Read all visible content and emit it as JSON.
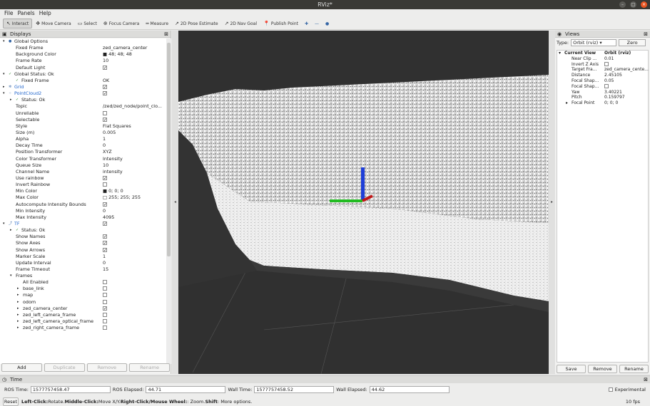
{
  "window": {
    "title": "RViz*"
  },
  "menu": [
    "File",
    "Panels",
    "Help"
  ],
  "toolbar": [
    {
      "label": "Interact",
      "icon": "interact-icon",
      "glyph": "↖",
      "active": true
    },
    {
      "label": "Move Camera",
      "icon": "move-camera-icon",
      "glyph": "✥"
    },
    {
      "label": "Select",
      "icon": "select-icon",
      "glyph": "▭"
    },
    {
      "label": "Focus Camera",
      "icon": "focus-camera-icon",
      "glyph": "⊕"
    },
    {
      "label": "Measure",
      "icon": "measure-icon",
      "glyph": "═"
    },
    {
      "label": "2D Pose Estimate",
      "icon": "pose-estimate-icon",
      "glyph": "↗"
    },
    {
      "label": "2D Nav Goal",
      "icon": "nav-goal-icon",
      "glyph": "↗"
    },
    {
      "label": "Publish Point",
      "icon": "publish-point-icon",
      "glyph": "📍"
    }
  ],
  "toolbar_extra": [
    "✚",
    "—",
    "●"
  ],
  "displays": {
    "title": "Displays",
    "rows": [
      {
        "label": "Global Options",
        "indent": 0,
        "arrow": "▾",
        "icon": "●",
        "value": ""
      },
      {
        "label": "Fixed Frame",
        "indent": 1,
        "value": "zed_camera_center"
      },
      {
        "label": "Background Color",
        "indent": 1,
        "value": "■ 48; 48; 48"
      },
      {
        "label": "Frame Rate",
        "indent": 1,
        "value": "10"
      },
      {
        "label": "Default Light",
        "indent": 1,
        "value": "✓",
        "check": true
      },
      {
        "label": "Global Status: Ok",
        "indent": 0,
        "arrow": "▾",
        "icon": "✓",
        "value": ""
      },
      {
        "label": "Fixed Frame",
        "indent": 1,
        "icon": "✓",
        "value": "OK"
      },
      {
        "label": "Grid",
        "indent": 0,
        "arrow": "▸",
        "icon": "✲",
        "value": "✓",
        "check": true,
        "blue": true
      },
      {
        "label": "PointCloud2",
        "indent": 0,
        "arrow": "▾",
        "icon": "⁘",
        "value": "✓",
        "check": true,
        "blue": true
      },
      {
        "label": "Status: Ok",
        "indent": 1,
        "arrow": "▸",
        "icon": "✓",
        "value": ""
      },
      {
        "label": "Topic",
        "indent": 1,
        "value": "/zed/zed_node/point_clo..."
      },
      {
        "label": "Unreliable",
        "indent": 1,
        "value": "",
        "check": true
      },
      {
        "label": "Selectable",
        "indent": 1,
        "value": "✓",
        "check": true
      },
      {
        "label": "Style",
        "indent": 1,
        "value": "Flat Squares"
      },
      {
        "label": "Size (m)",
        "indent": 1,
        "value": "0.005"
      },
      {
        "label": "Alpha",
        "indent": 1,
        "value": "1"
      },
      {
        "label": "Decay Time",
        "indent": 1,
        "value": "0"
      },
      {
        "label": "Position Transformer",
        "indent": 1,
        "value": "XYZ"
      },
      {
        "label": "Color Transformer",
        "indent": 1,
        "value": "Intensity"
      },
      {
        "label": "Queue Size",
        "indent": 1,
        "value": "10"
      },
      {
        "label": "Channel Name",
        "indent": 1,
        "value": "intensity"
      },
      {
        "label": "Use rainbow",
        "indent": 1,
        "value": "✓",
        "check": true
      },
      {
        "label": "Invert Rainbow",
        "indent": 1,
        "value": "",
        "check": true
      },
      {
        "label": "Min Color",
        "indent": 1,
        "value": "■ 0; 0; 0"
      },
      {
        "label": "Max Color",
        "indent": 1,
        "value": "□ 255; 255; 255"
      },
      {
        "label": "Autocompute Intensity Bounds",
        "indent": 1,
        "value": "✓",
        "check": true
      },
      {
        "label": "Min Intensity",
        "indent": 1,
        "value": "0"
      },
      {
        "label": "Max Intensity",
        "indent": 1,
        "value": "4095"
      },
      {
        "label": "TF",
        "indent": 0,
        "arrow": "▾",
        "icon": "⤴",
        "value": "✓",
        "check": true,
        "blue": true
      },
      {
        "label": "Status: Ok",
        "indent": 1,
        "arrow": "▸",
        "icon": "✓",
        "value": ""
      },
      {
        "label": "Show Names",
        "indent": 1,
        "value": "✓",
        "check": true
      },
      {
        "label": "Show Axes",
        "indent": 1,
        "value": "✓",
        "check": true
      },
      {
        "label": "Show Arrows",
        "indent": 1,
        "value": "✓",
        "check": true
      },
      {
        "label": "Marker Scale",
        "indent": 1,
        "value": "1"
      },
      {
        "label": "Update Interval",
        "indent": 1,
        "value": "0"
      },
      {
        "label": "Frame Timeout",
        "indent": 1,
        "value": "15"
      },
      {
        "label": "Frames",
        "indent": 1,
        "arrow": "▾",
        "value": ""
      },
      {
        "label": "All Enabled",
        "indent": 2,
        "value": "",
        "check": true
      },
      {
        "label": "base_link",
        "indent": 2,
        "arrow": "▸",
        "value": "",
        "check": true
      },
      {
        "label": "map",
        "indent": 2,
        "arrow": "▸",
        "value": "",
        "check": true
      },
      {
        "label": "odom",
        "indent": 2,
        "arrow": "▸",
        "value": "",
        "check": true
      },
      {
        "label": "zed_camera_center",
        "indent": 2,
        "arrow": "▸",
        "value": "✓",
        "check": true
      },
      {
        "label": "zed_left_camera_frame",
        "indent": 2,
        "arrow": "▸",
        "value": "",
        "check": true
      },
      {
        "label": "zed_left_camera_optical_frame",
        "indent": 2,
        "arrow": "▸",
        "value": "",
        "check": true
      },
      {
        "label": "zed_right_camera_frame",
        "indent": 2,
        "arrow": "▸",
        "value": "",
        "check": true
      }
    ],
    "buttons": [
      {
        "label": "Add",
        "enabled": true
      },
      {
        "label": "Duplicate",
        "enabled": false
      },
      {
        "label": "Remove",
        "enabled": false
      },
      {
        "label": "Rename",
        "enabled": false
      }
    ]
  },
  "views": {
    "title": "Views",
    "type_label": "Type:",
    "type_value": "Orbit (rviz)",
    "zero_label": "Zero",
    "current_view": {
      "label": "Current View",
      "value": "Orbit (rviz)"
    },
    "rows": [
      {
        "label": "Near Clip ...",
        "value": "0.01"
      },
      {
        "label": "Invert Z Axis",
        "value": "",
        "check": true
      },
      {
        "label": "Target Fra...",
        "value": "zed_camera_cente..."
      },
      {
        "label": "Distance",
        "value": "2.45105"
      },
      {
        "label": "Focal Shap...",
        "value": "0.05"
      },
      {
        "label": "Focal Shap...",
        "value": "",
        "check": true
      },
      {
        "label": "Yaw",
        "value": "3.40221"
      },
      {
        "label": "Pitch",
        "value": "0.159797"
      },
      {
        "label": "Focal Point",
        "value": "0; 0; 0",
        "arrow": "▸"
      }
    ],
    "buttons": [
      "Save",
      "Remove",
      "Rename"
    ]
  },
  "time": {
    "title": "Time",
    "ros_time_label": "ROS Time:",
    "ros_time": "1577757458.47",
    "ros_elapsed_label": "ROS Elapsed:",
    "ros_elapsed": "44.71",
    "wall_time_label": "Wall Time:",
    "wall_time": "1577757458.52",
    "wall_elapsed_label": "Wall Elapsed:",
    "wall_elapsed": "44.62",
    "experimental_label": "Experimental"
  },
  "status": {
    "reset_label": "Reset",
    "hint_bold1": "Left-Click:",
    "hint1": " Rotate. ",
    "hint_bold2": "Middle-Click:",
    "hint2": " Move X/Y. ",
    "hint_bold3": "Right-Click/Mouse Wheel:",
    "hint3": ": Zoom. ",
    "hint_bold4": "Shift",
    "hint4": ": More options.",
    "fps": "10 fps"
  }
}
